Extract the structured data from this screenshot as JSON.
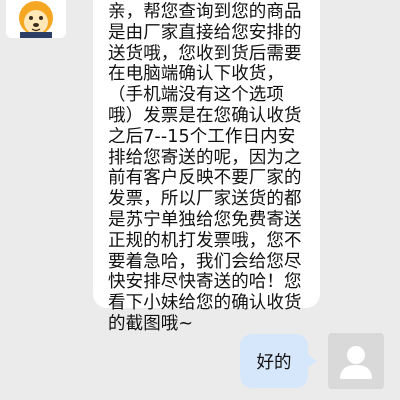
{
  "messages": {
    "agent": {
      "avatar_icon": "lion-mascot-avatar-icon",
      "text": "亲，帮您查询到您的商品\n是由厂家直接给您安排的\n送货哦，您收到货后需要\n在电脑端确认下收货，\n（手机端没有这个选项\n哦）发票是在您确认收货\n之后7--15个工作日内安\n排给您寄送的呢，因为之\n前有客户反映不要厂家的\n发票，所以厂家送货的都\n是苏宁单独给您免费寄送\n正规的机打发票哦，您不\n要着急哈，我们会给您尽\n快安排尽快寄送的哈！您\n看下小妹给您的确认收货\n的截图哦~"
    },
    "user": {
      "avatar_icon": "default-user-avatar-icon",
      "text": "好的"
    }
  },
  "colors": {
    "background": "#ebebeb",
    "incoming_bubble": "#ffffff",
    "outgoing_bubble": "#d6e7fb",
    "mascot_orange": "#f5a623"
  }
}
